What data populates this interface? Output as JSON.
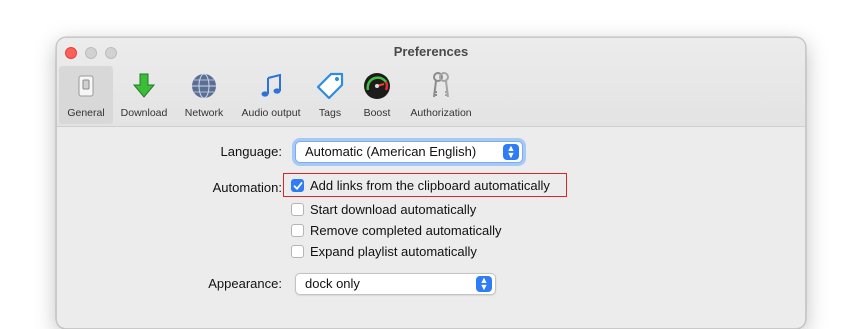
{
  "window": {
    "title": "Preferences"
  },
  "toolbar": {
    "items": [
      {
        "label": "General",
        "icon": "general-switch-icon"
      },
      {
        "label": "Download",
        "icon": "download-arrow-icon"
      },
      {
        "label": "Network",
        "icon": "globe-icon"
      },
      {
        "label": "Audio output",
        "icon": "music-note-icon"
      },
      {
        "label": "Tags",
        "icon": "tag-icon"
      },
      {
        "label": "Boost",
        "icon": "speedometer-icon"
      },
      {
        "label": "Authorization",
        "icon": "keys-icon"
      }
    ],
    "selected": "General"
  },
  "general": {
    "language_label": "Language:",
    "language_value": "Automatic (American English)",
    "automation_label": "Automation:",
    "options": [
      {
        "label": "Add links from the clipboard automatically",
        "checked": true
      },
      {
        "label": "Start download automatically",
        "checked": false
      },
      {
        "label": "Remove completed automatically",
        "checked": false
      },
      {
        "label": "Expand playlist automatically",
        "checked": false
      }
    ],
    "appearance_label": "Appearance:",
    "appearance_value": "dock only"
  },
  "colors": {
    "accent": "#2f7df6",
    "highlight": "#d9262a"
  }
}
